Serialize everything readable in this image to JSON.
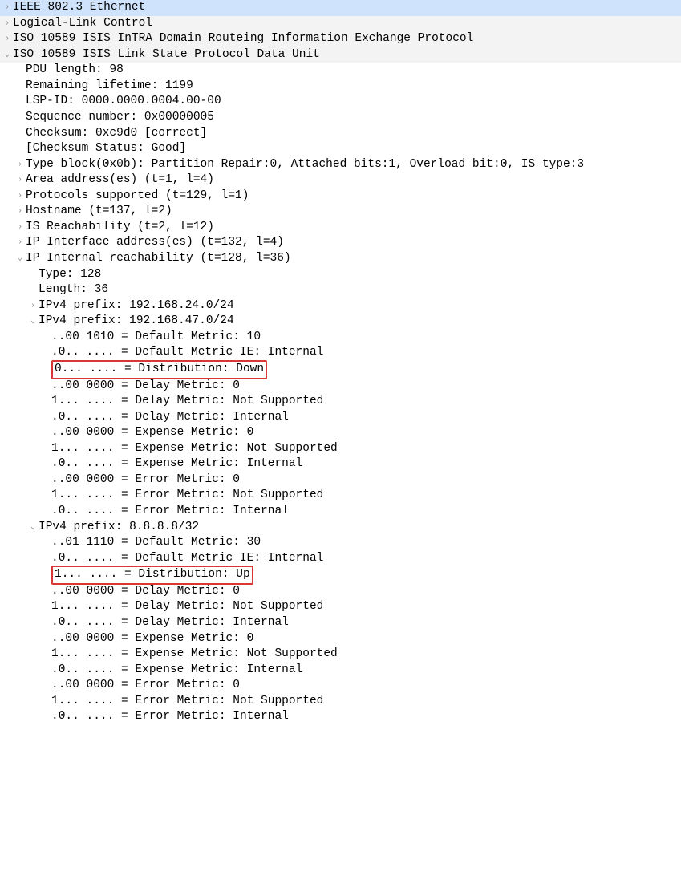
{
  "top": {
    "ethernet": "IEEE 802.3 Ethernet",
    "llc": "Logical-Link Control",
    "isis1": "ISO 10589 ISIS InTRA Domain Routeing Information Exchange Protocol",
    "isis2": "ISO 10589 ISIS Link State Protocol Data Unit"
  },
  "lsp": {
    "pdu_length": "PDU length: 98",
    "remaining_lifetime": "Remaining lifetime: 1199",
    "lsp_id": "LSP-ID: 0000.0000.0004.00-00",
    "seq": "Sequence number: 0x00000005",
    "checksum": "Checksum: 0xc9d0 [correct]",
    "checksum_status": "[Checksum Status: Good]",
    "typeblock": "Type block(0x0b): Partition Repair:0, Attached bits:1, Overload bit:0, IS type:3",
    "area": "Area address(es) (t=1, l=4)",
    "protos": "Protocols supported (t=129, l=1)",
    "hostname": "Hostname (t=137, l=2)",
    "is_reach": "IS Reachability (t=2, l=12)",
    "ip_iface": "IP Interface address(es) (t=132, l=4)",
    "ip_internal": "IP Internal reachability (t=128, l=36)"
  },
  "internal": {
    "type": "Type: 128",
    "length": "Length: 36",
    "prefix1_hdr": "IPv4 prefix: 192.168.24.0/24",
    "prefix2_hdr": "IPv4 prefix: 192.168.47.0/24",
    "p2": {
      "m0": "..00 1010 = Default Metric: 10",
      "m1": ".0.. .... = Default Metric IE: Internal",
      "m2": "0... .... = Distribution: Down",
      "m3": "..00 0000 = Delay Metric: 0",
      "m4": "1... .... = Delay Metric: Not Supported",
      "m5": ".0.. .... = Delay Metric: Internal",
      "m6": "..00 0000 = Expense Metric: 0",
      "m7": "1... .... = Expense Metric: Not Supported",
      "m8": ".0.. .... = Expense Metric: Internal",
      "m9": "..00 0000 = Error Metric: 0",
      "m10": "1... .... = Error Metric: Not Supported",
      "m11": ".0.. .... = Error Metric: Internal"
    },
    "prefix3_hdr": "IPv4 prefix: 8.8.8.8/32",
    "p3": {
      "m0": "..01 1110 = Default Metric: 30",
      "m1": ".0.. .... = Default Metric IE: Internal",
      "m2": "1... .... = Distribution: Up",
      "m3": "..00 0000 = Delay Metric: 0",
      "m4": "1... .... = Delay Metric: Not Supported",
      "m5": ".0.. .... = Delay Metric: Internal",
      "m6": "..00 0000 = Expense Metric: 0",
      "m7": "1... .... = Expense Metric: Not Supported",
      "m8": ".0.. .... = Expense Metric: Internal",
      "m9": "..00 0000 = Error Metric: 0",
      "m10": "1... .... = Error Metric: Not Supported",
      "m11": ".0.. .... = Error Metric: Internal"
    }
  }
}
